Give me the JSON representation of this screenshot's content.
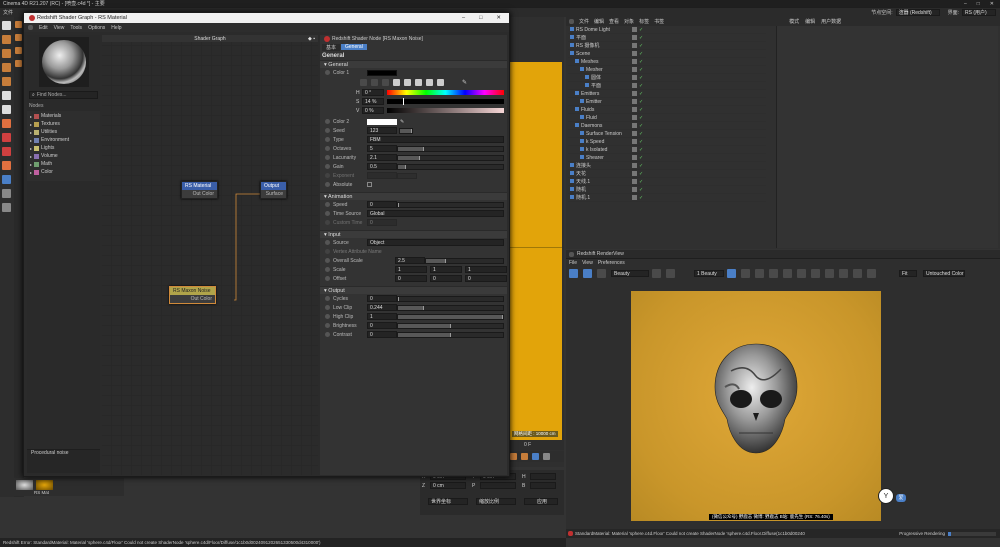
{
  "main_window": {
    "title": "Cinema 4D R21.207 (RC) - [喷壶.c4d *] - 主要",
    "menu_file": "文件",
    "right_menu_label": "节点空间:",
    "right_menu_value": "渲器 (Redshift)",
    "layout_label": "界面:",
    "layout_value": "RS (用户)"
  },
  "shader_window": {
    "title": "Redshift Shader Graph - RS Material",
    "menu": [
      "Edit",
      "View",
      "Tools",
      "Options",
      "Help"
    ],
    "graph_title": "Shader Graph",
    "find_nodes_placeholder": "Find Nodes...",
    "nodes_header": "Nodes",
    "categories": [
      {
        "label": "Materials",
        "color": "#b35050"
      },
      {
        "label": "Textures",
        "color": "#b8a050"
      },
      {
        "label": "Utilities",
        "color": "#b8b070"
      },
      {
        "label": "Environment",
        "color": "#7080b0"
      },
      {
        "label": "Lights",
        "color": "#c8c070"
      },
      {
        "label": "Volume",
        "color": "#8a70b0"
      },
      {
        "label": "Math",
        "color": "#70a070"
      },
      {
        "label": "Color",
        "color": "#c060a0"
      }
    ],
    "description": "Procedural noise",
    "nodes": {
      "material": {
        "title": "RS Material",
        "port": "Out Color"
      },
      "output": {
        "title": "Output",
        "port": "Surface"
      },
      "maxon_noise": {
        "title": "RS Maxon Noise",
        "port": "Out Color"
      }
    }
  },
  "attributes": {
    "header": "Redshift Shader Node [RS Maxon Noise]",
    "tabs": [
      "基本",
      "General"
    ],
    "section_title": "General",
    "general": {
      "title": "General",
      "color1_label": "Color 1",
      "h_label": "H",
      "h_value": "0 °",
      "s_label": "S",
      "s_value": "14 %",
      "v_label": "V",
      "v_value": "0 %",
      "color2_label": "Color 2",
      "seed_label": "Seed",
      "seed_value": "123",
      "type_label": "Type",
      "type_value": "FBM",
      "octaves_label": "Octaves",
      "octaves_value": "5",
      "lacunarity_label": "Lacunarity",
      "lacunarity_value": "2.1",
      "gain_label": "Gain",
      "gain_value": "0.5",
      "exponent_label": "Exponent",
      "absolute_label": "Absolute"
    },
    "animation": {
      "title": "Animation",
      "speed_label": "Speed",
      "speed_value": "0",
      "time_source_label": "Time Source",
      "time_source_value": "Global",
      "custom_time_label": "Custom Time",
      "custom_time_value": "0"
    },
    "input": {
      "title": "Input",
      "source_label": "Source",
      "source_value": "Object",
      "vertex_attr_label": "Vertex Attribute Name",
      "overall_scale_label": "Overall Scale",
      "overall_scale_value": "2.5",
      "scale_label": "Scale",
      "scale_values": [
        "1",
        "1",
        "1"
      ],
      "offset_label": "Offset",
      "offset_values": [
        "0",
        "0",
        "0"
      ]
    },
    "output": {
      "title": "Output",
      "cycles_label": "Cycles",
      "cycles_value": "0",
      "low_clip_label": "Low Clip",
      "low_clip_value": "0.244",
      "high_clip_label": "High Clip",
      "high_clip_value": "1",
      "brightness_label": "Brightness",
      "brightness_value": "0",
      "contrast_label": "Contrast",
      "contrast_value": "0"
    }
  },
  "object_manager": {
    "menu": [
      "文件",
      "编辑",
      "查看",
      "对象",
      "标签",
      "书签"
    ],
    "attr_menu": [
      "模式",
      "编辑",
      "用户数据"
    ],
    "objects": [
      {
        "name": "RS Dome Light",
        "indent": 0
      },
      {
        "name": "平面",
        "indent": 0
      },
      {
        "name": "RS 摄像机",
        "indent": 0
      },
      {
        "name": "Scene",
        "indent": 0
      },
      {
        "name": "Meshes",
        "indent": 1
      },
      {
        "name": "Mesher",
        "indent": 2
      },
      {
        "name": "圆体",
        "indent": 3
      },
      {
        "name": "平面",
        "indent": 3
      },
      {
        "name": "Emitters",
        "indent": 1
      },
      {
        "name": "Emitter",
        "indent": 2
      },
      {
        "name": "Fluids",
        "indent": 1
      },
      {
        "name": "Fluid",
        "indent": 2
      },
      {
        "name": "Daemons",
        "indent": 1
      },
      {
        "name": "Surface Tension",
        "indent": 2
      },
      {
        "name": "k Speed",
        "indent": 2
      },
      {
        "name": "k Isolated",
        "indent": 2
      },
      {
        "name": "Shearer",
        "indent": 2
      },
      {
        "name": "连接头",
        "indent": 0
      },
      {
        "name": "天花",
        "indent": 0
      },
      {
        "name": "天线.1",
        "indent": 0
      },
      {
        "name": "随机",
        "indent": 0
      },
      {
        "name": "随机.1",
        "indent": 0
      }
    ]
  },
  "render_view": {
    "title": "Redshift RenderView",
    "menu": [
      "File",
      "View",
      "Preferences"
    ],
    "beauty": "Beauty",
    "aov": "1 Beauty",
    "zoom": "Fit",
    "color_mode": "Untouched Color",
    "caption": "(微信公众号) 野鹿志  微博: 野鹿志  B站: 鹿先生 (RS: 76.40s)",
    "badge": "爱"
  },
  "viewport": {
    "grid_distance": "网格间距 : 10000 cm",
    "frame": "0 F"
  },
  "coords": {
    "x_label": "X",
    "y_label": "Y",
    "z_label": "Z",
    "values": [
      "0 cm",
      "0 cm",
      "0 cm"
    ],
    "h_label": "H",
    "p_label": "P",
    "b_label": "B",
    "world_label": "世界坐标",
    "scale_label": "缩放比例",
    "apply": "应用"
  },
  "materials": {
    "items": [
      "RS Mat"
    ]
  },
  "status_bar": {
    "left": "Redshift Error: StandardMaterial: Material 'sphere.c4d/Floor' Could not create ShaderNode 'sphere.c4d/Floor/Diffuse/1c1b0d0024091202651330500d4310000')",
    "right_error": "StandardMaterial: Material 'sphere.c4d.Floor' Could not create ShaderNode 'sphere.c4d.Floor.Diffuse(1c1b0d0024091)'",
    "progressive": "Progressive Rendering"
  },
  "colors": {
    "orange_bg": "#e2a40a",
    "render_bg": "#cc9a2a",
    "accent_blue": "#4a7fc7",
    "node_red": "#c04040",
    "node_blue": "#3a5ea8"
  }
}
